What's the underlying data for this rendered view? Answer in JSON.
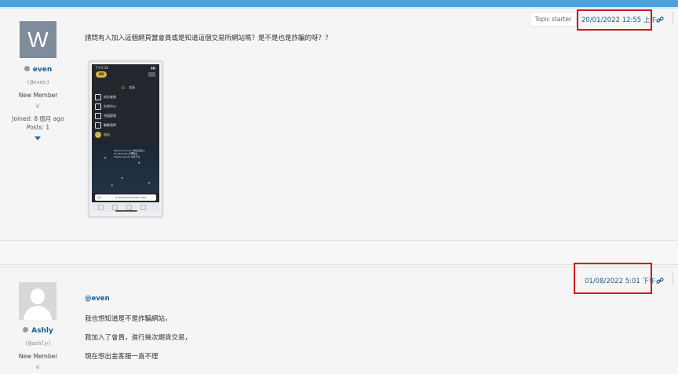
{
  "posts": [
    {
      "author": {
        "avatar_letter": "W",
        "name": "even",
        "handle": "(@even)",
        "role": "New Member",
        "joined": "Joined: 8 個月 ago",
        "posts": "Posts: 1"
      },
      "badge": "Topic starter",
      "date": "20/01/2022 12:55 上午",
      "text": "請問有人加入這個網頁當會員或是知道這個交易所網站嗎？是不是也是詐騙的呀？？",
      "attachment": {
        "status_time": "下午5:16",
        "logo": "GD",
        "menu_home": "首頁",
        "menu_items": [
          "成交查詢",
          "交易中心",
          "充值提現",
          "聯繫我們",
          "退出"
        ],
        "banner_text": "Welcome to join 歡迎您加入 GD Markets 全球領先 Digital Assets 交易平台",
        "url_aa": "AA",
        "url": "m.starfoxmarkets.com"
      }
    },
    {
      "author": {
        "name": "Ashly",
        "handle": "(@ashly)",
        "role": "New Member"
      },
      "date": "01/08/2022 5:01 下午",
      "mention": "@even",
      "lines": [
        "我也想知道是不是詐騙網站，",
        "我加入了會員，進行幾次期貨交易，",
        "現在想出金客服一直不理"
      ]
    }
  ],
  "colors": {
    "accent": "#4aa3df",
    "link": "#1d5b8f",
    "highlight_box": "#d3131f"
  },
  "icons": {
    "link": "link-icon",
    "status": "offline-status-icon",
    "rank": "medal-icon",
    "expand": "caret-down-icon"
  }
}
